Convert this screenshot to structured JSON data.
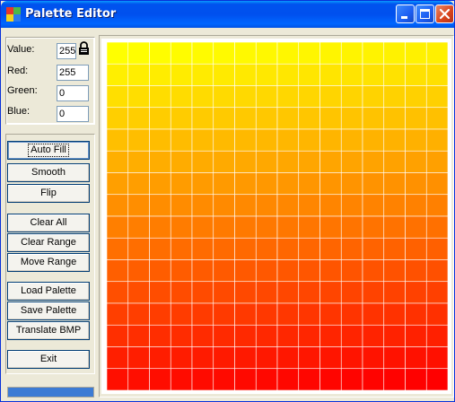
{
  "window": {
    "title": "Palette Editor"
  },
  "fields": {
    "value": {
      "label": "Value:",
      "value": "255"
    },
    "red": {
      "label": "Red:",
      "value": "255"
    },
    "green": {
      "label": "Green:",
      "value": "0"
    },
    "blue": {
      "label": "Blue:",
      "value": "0"
    }
  },
  "buttons": {
    "auto_fill": "Auto Fill",
    "smooth": "Smooth",
    "flip": "Flip",
    "clear_all": "Clear All",
    "clear_range": "Clear Range",
    "move_range": "Move Range",
    "load_palette": "Load Palette",
    "save_palette": "Save Palette",
    "translate_bmp": "Translate BMP",
    "exit": "Exit"
  },
  "palette": {
    "columns": 16,
    "rows": 16,
    "color_start": "#ffff00",
    "color_end": "#ff0000",
    "gridline_color": "#ffffff"
  },
  "colors": {
    "titlebar": "#0054e3",
    "window_face": "#ece9d8",
    "status_fill": "#3c7bd4"
  }
}
